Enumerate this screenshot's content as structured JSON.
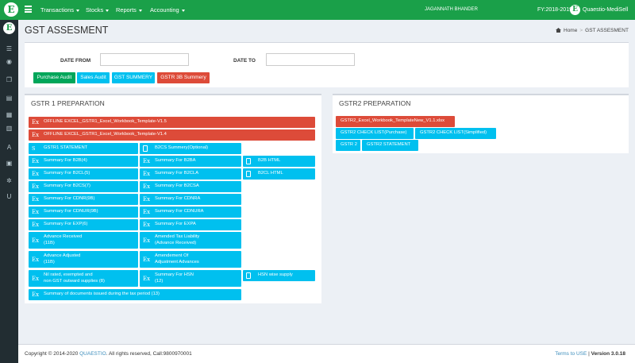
{
  "header": {
    "logo_letter": "E",
    "menu": [
      {
        "label": "Transactions"
      },
      {
        "label": "Stocks"
      },
      {
        "label": "Reports"
      },
      {
        "label": "Accounting"
      }
    ],
    "user": "JAGANNATH BHANDER",
    "fy": "FY:2018-2019",
    "app_name": "Quaestio-MediSell",
    "colors": {
      "brand": "#1aa049",
      "sidebar": "#222d32"
    }
  },
  "sidebar": {
    "icons": [
      "list-icon",
      "dashboard-icon",
      "boxes-icon",
      "document-icon",
      "report-icon",
      "table-icon",
      "font-icon",
      "book-icon",
      "settings-icon",
      "underline-icon"
    ]
  },
  "page": {
    "title": "GST ASSESMENT",
    "breadcrumb": {
      "home": "Home",
      "current": "GST ASSESMENT"
    }
  },
  "filters": {
    "date_from_label": "DATE FROM",
    "date_from_value": "",
    "date_to_label": "DATE TO",
    "date_to_value": "",
    "buttons": [
      {
        "label": "Purchase Audit",
        "color": "#00a65a"
      },
      {
        "label": "Sales Audit",
        "color": "#00c0ef"
      },
      {
        "label": "GST SUMMERY",
        "color": "#00c0ef"
      },
      {
        "label": "GSTR 3B Summery",
        "color": "#dd4b39"
      }
    ]
  },
  "gstr1": {
    "title": "GSTR 1 PREPARATION",
    "offline": [
      "OFFLINE EXCEL_GSTR1_Excel_Workbook_Template-V1.5",
      "OFFLINE EXCEL_GSTR1_Excel_Workbook_Template-V1.4"
    ],
    "gstr1_statement": "GSTR1 STATEMENT",
    "b2cs_optional": "B2CS Summery(Optional)",
    "b2b": "Summary For B2B(4)",
    "b2ba": "Summary For B2BA",
    "b2b_html": "B2B HTML",
    "b2cl": "Summary For B2CL(5)",
    "b2cla": "Summary For B2CLA",
    "b2cl_html": "B2CL HTML",
    "b2cs": "Summary For B2CS(7)",
    "b2csa": "Summary For B2CSA",
    "cdnr": "Summary For CDNR(9B)",
    "cdnra": "Summary For CDNRA",
    "cdnur": "Summary For CDNUR(9B)",
    "cdnura": "Summary For CDNURA",
    "exp": "Summary For EXP(6)",
    "expa": "Summary For EXPA",
    "adv_received": [
      "Advance Received",
      "(11B)"
    ],
    "amended_tax": [
      "Amended Tax Liability",
      "(Advance Received)"
    ],
    "adv_adjusted": [
      "Advance Adjusted",
      "(11B)"
    ],
    "amendment_adj": [
      "Amendement Of",
      "Adjustment Advances"
    ],
    "nil_rated": [
      "Nil rated, exempted and",
      "non GST outward supplies (8)"
    ],
    "hsn": [
      "Summary For HSN",
      "(12)"
    ],
    "hsn_supply": "HSN wise supply",
    "docs_issued": "Summary of documents issued during the tax period (13)",
    "ex_icon": "Ex",
    "s_icon": "S"
  },
  "gstr2": {
    "title": "GSTR2 PREPARATION",
    "template": "GSTR2_Excel_Workbook_TemplateNew_V1.1.xlsx",
    "check_purchase": "GSTR2 CHECK LIST(Purchase)",
    "check_simplified": "GSTR2 CHECK LIST(Simplified)",
    "gstr2": "GSTR 2",
    "statement": "GSTR2 STATEMENT"
  },
  "footer": {
    "copyright_pre": "Copyright © 2014-2020 ",
    "company": "QUAESTIO",
    "copyright_post": ". All rights reserved, Call:9800970001",
    "terms": "Terms to USE",
    "version_pre": " | ",
    "version": "Version 3.0.18"
  }
}
